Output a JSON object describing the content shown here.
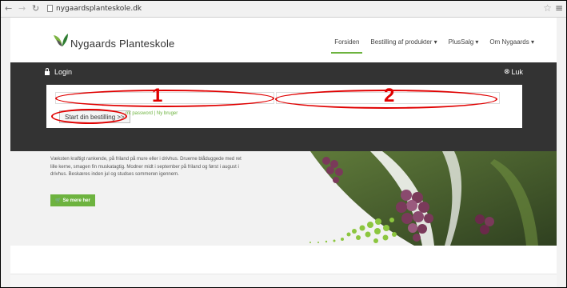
{
  "browser": {
    "back_icon": "arrow-left-icon",
    "forward_icon": "arrow-right-icon",
    "reload_icon": "reload-icon",
    "url": "nygaardsplanteskole.dk",
    "star_icon": "star-icon",
    "menu_icon": "hamburger-icon"
  },
  "header": {
    "brand": "Nygaards Planteskole",
    "nav": [
      {
        "label": "Forsiden",
        "active": true
      },
      {
        "label": "Bestilling af produkter ▾"
      },
      {
        "label": "PlusSalg ▾"
      },
      {
        "label": "Om Nygaards ▾"
      }
    ]
  },
  "login_bar": {
    "title": "Login",
    "close_label": "Luk",
    "start_button": "Start din bestilling >>",
    "links": "mt password | Ny bruger"
  },
  "annotations": {
    "label_1": "1",
    "label_2": "2"
  },
  "hero": {
    "text": "Væksten kraftigt rankende, på friland på mure eller i drivhus. Druerne blåduggede med ret lille kerne, smagen fin muskatagtig. Modner midt i september på friland og først i august i drivhus. Beskæres inden jul og studses sommeren igennem.",
    "button": "Se mere her"
  },
  "colors": {
    "accent_green": "#6db33f",
    "dark_bar": "#333333",
    "annotation_red": "#e00000"
  }
}
